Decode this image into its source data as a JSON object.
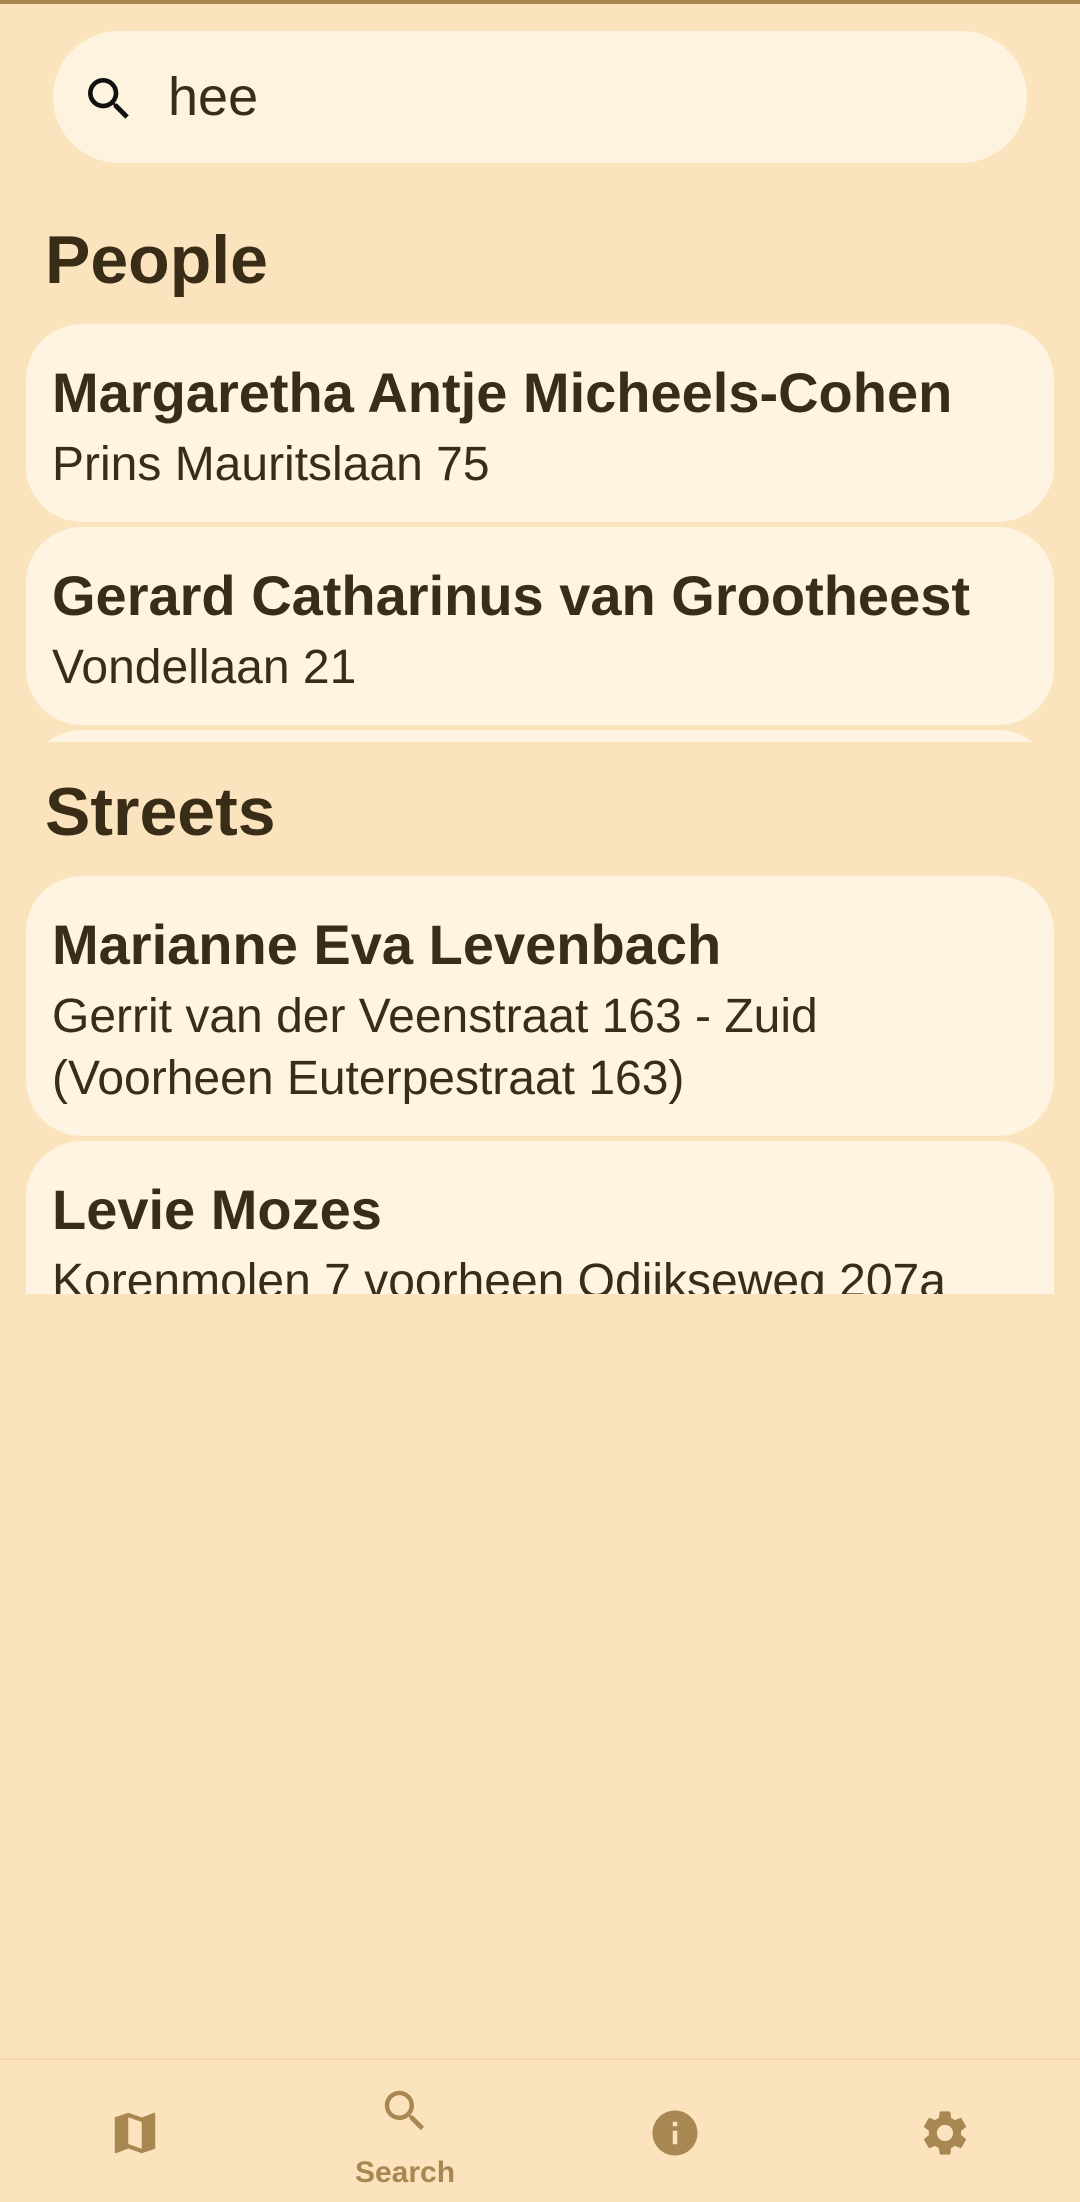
{
  "search": {
    "value": "hee",
    "icon": "search-icon"
  },
  "people": {
    "title": "People",
    "items": [
      {
        "name": "Margaretha Antje Micheels-Cohen",
        "address": "Prins Mauritslaan 75"
      },
      {
        "name": "Gerard Catharinus van Grootheest",
        "address": "Vondellaan 21"
      }
    ]
  },
  "streets": {
    "title": "Streets",
    "items": [
      {
        "name": "Marianne Eva Levenbach",
        "address": "Gerrit van der Veenstraat 163 - Zuid (Voorheen Euterpestraat 163)"
      },
      {
        "name": "Levie Mozes",
        "address": "Korenmolen 7 voorheen Odijkseweg 207a"
      }
    ]
  },
  "nav": {
    "items": [
      {
        "icon": "map-icon",
        "label": ""
      },
      {
        "icon": "search-icon",
        "label": "Search",
        "selected": true
      },
      {
        "icon": "info-icon",
        "label": ""
      },
      {
        "icon": "gear-icon",
        "label": ""
      }
    ]
  },
  "colors": {
    "background": "#fbe4bd",
    "card": "#fef4e1",
    "text": "#3a2d17",
    "accent": "#a88752"
  }
}
